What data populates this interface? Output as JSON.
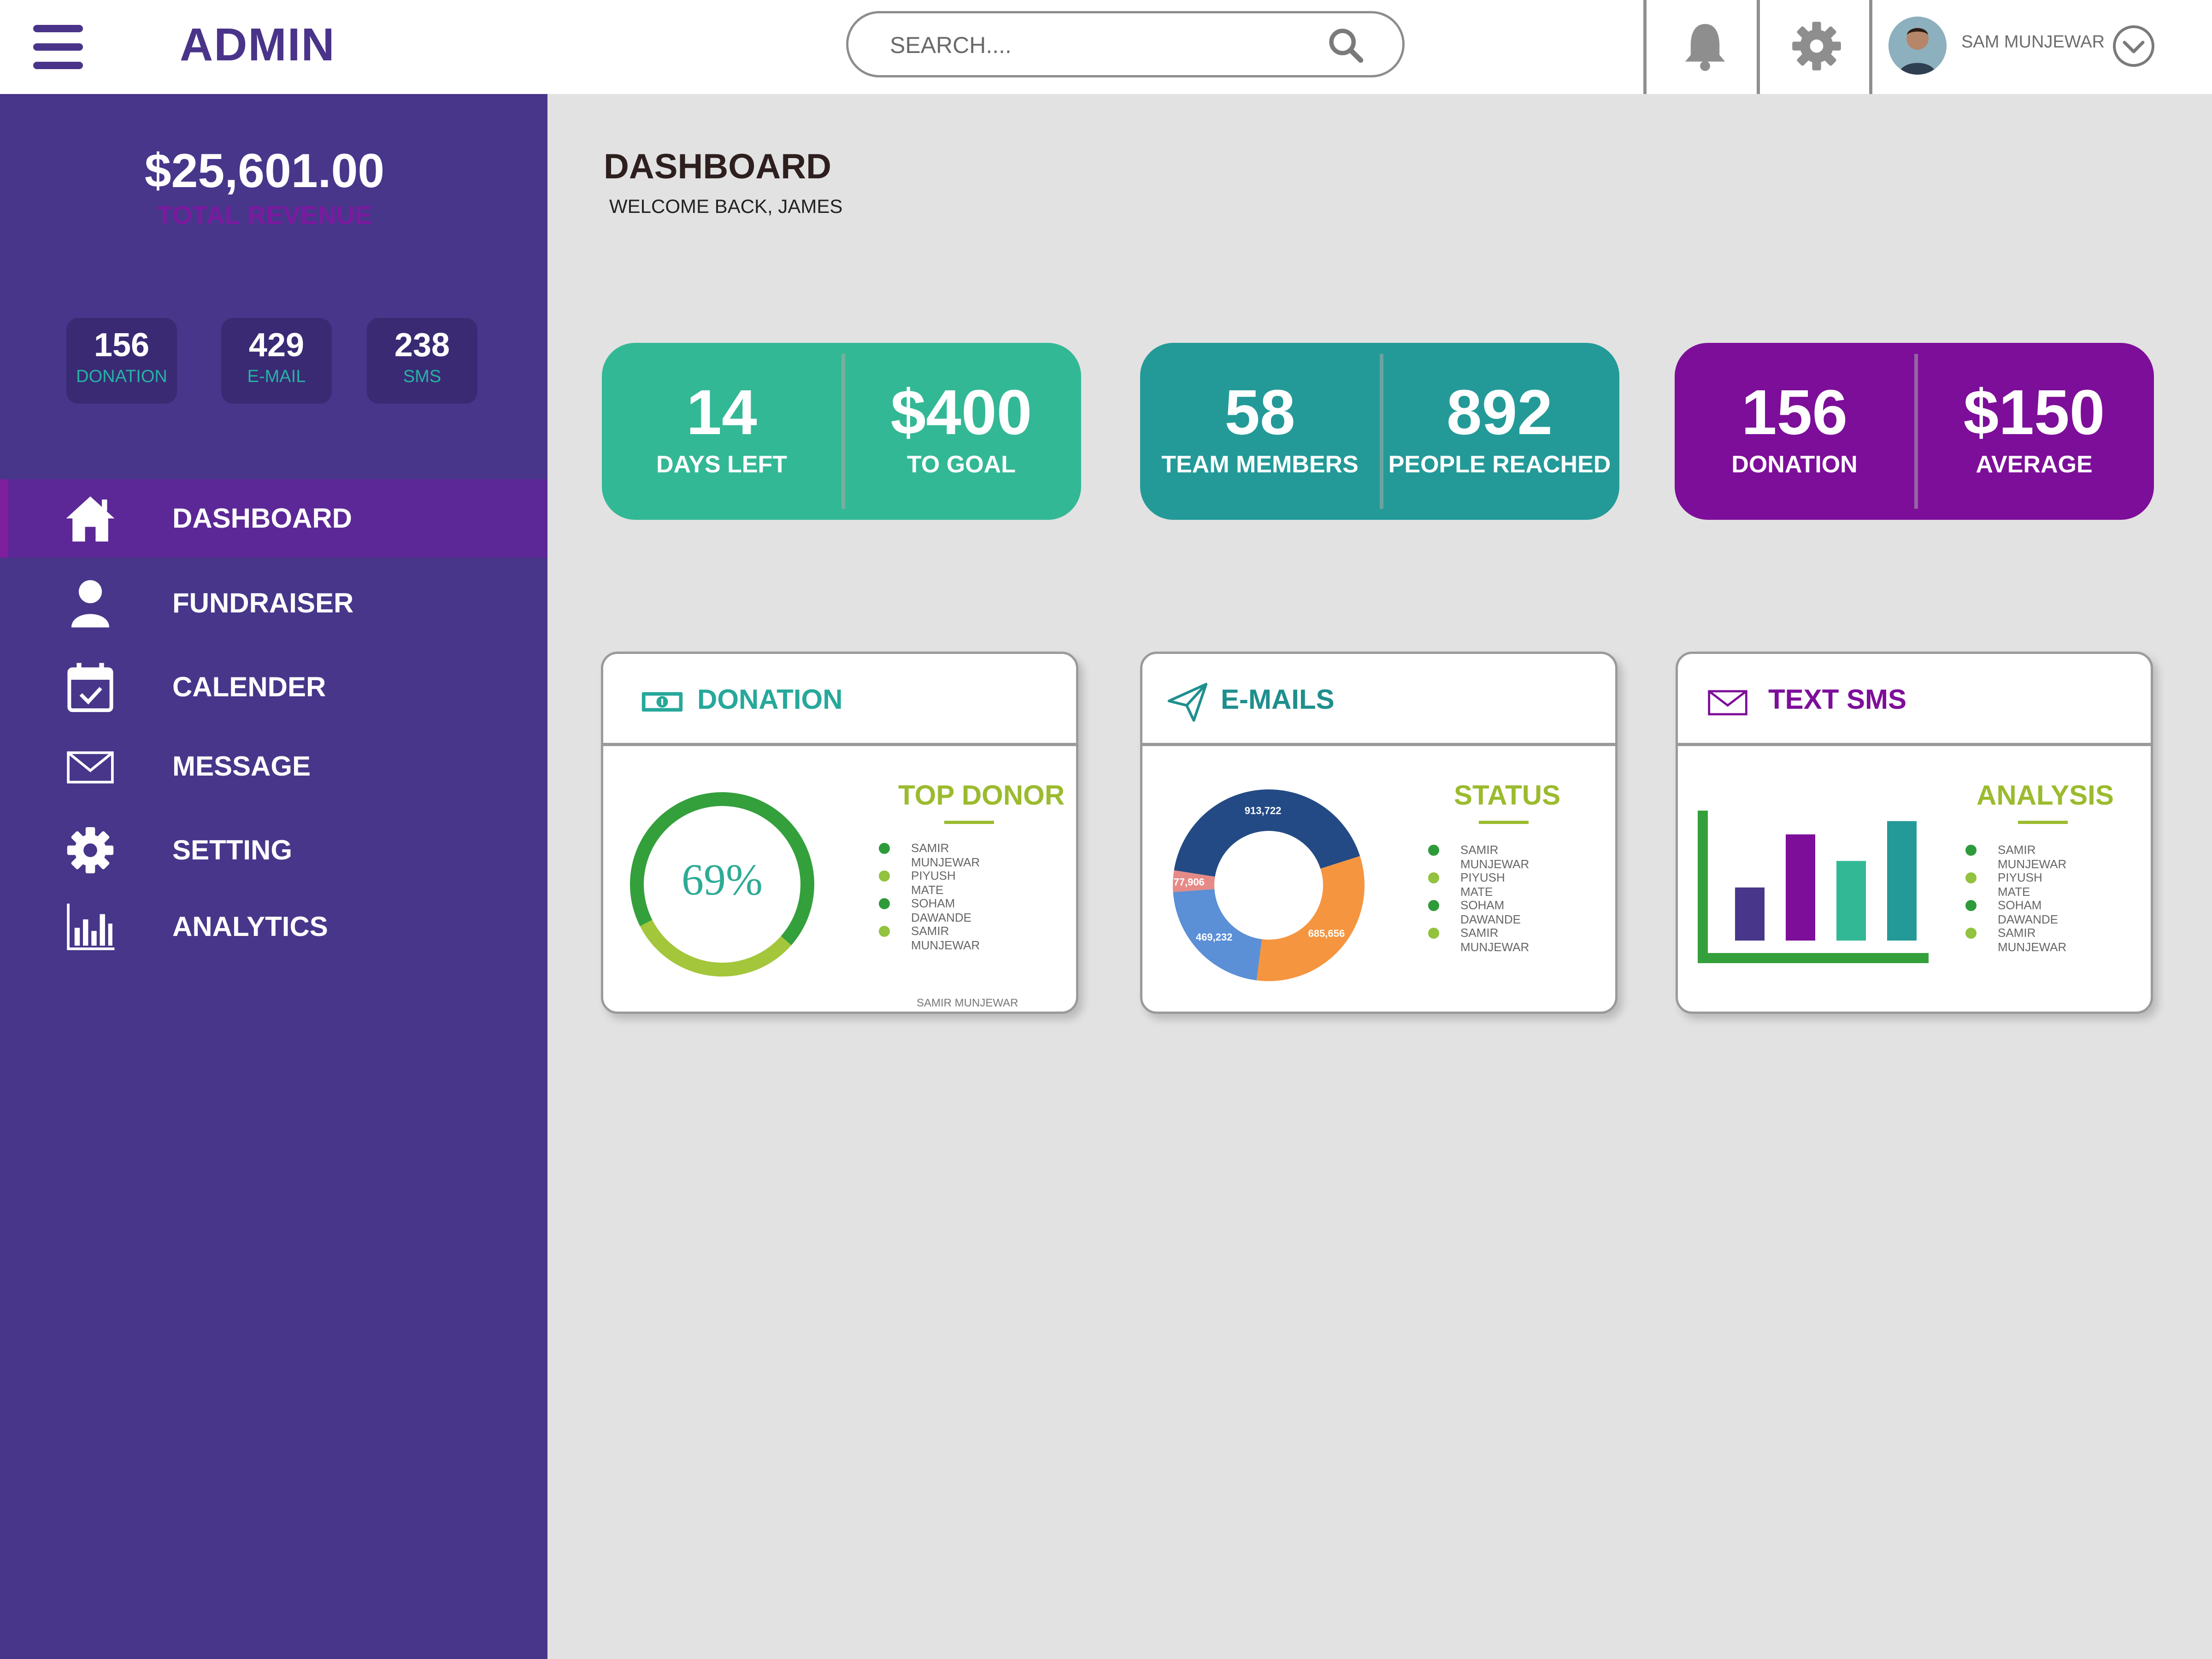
{
  "header": {
    "brand": "ADMIN",
    "search_placeholder": "SEARCH....",
    "user_name": "SAM MUNJEWAR"
  },
  "sidebar": {
    "revenue_value": "$25,601.00",
    "revenue_label": "TOTAL REVENUE",
    "mini_stats": [
      {
        "value": "156",
        "label": "DONATION"
      },
      {
        "value": "429",
        "label": "E-MAIL"
      },
      {
        "value": "238",
        "label": "SMS"
      }
    ],
    "nav": [
      {
        "label": "DASHBOARD",
        "icon": "home-icon",
        "active": true
      },
      {
        "label": "FUNDRAISER",
        "icon": "user-icon",
        "active": false
      },
      {
        "label": "CALENDER",
        "icon": "calendar-icon",
        "active": false
      },
      {
        "label": "MESSAGE",
        "icon": "envelope-icon",
        "active": false
      },
      {
        "label": "SETTING",
        "icon": "gear-icon",
        "active": false
      },
      {
        "label": "ANALYTICS",
        "icon": "bar-chart-icon",
        "active": false
      }
    ]
  },
  "main": {
    "title": "DASHBOARD",
    "subtitle": "WELCOME BACK,  JAMES"
  },
  "stat_cards": [
    {
      "color": "#33b895",
      "left_value": "14",
      "left_label": "DAYS LEFT",
      "right_value": "$400",
      "right_label": "TO GOAL"
    },
    {
      "color": "#239a98",
      "left_value": "58",
      "left_label": "TEAM MEMBERS",
      "right_value": "892",
      "right_label": "PEOPLE REACHED"
    },
    {
      "color": "#7d0e99",
      "left_value": "156",
      "left_label": "DONATION",
      "right_value": "$150",
      "right_label": "AVERAGE"
    }
  ],
  "cards": {
    "donation": {
      "title": "DONATION",
      "title_color": "#26a89a",
      "icon": "money-icon",
      "section_title": "TOP DONOR",
      "legend": [
        "SAMIR MUNJEWAR",
        "PIYUSH MATE",
        "SOHAM DAWANDE",
        "SAMIR MUNJEWAR"
      ],
      "extra_label": "SAMIR MUNJEWAR"
    },
    "emails": {
      "title": "E-MAILS",
      "title_color": "#1f8f8d",
      "icon": "paper-plane-icon",
      "section_title": "STATUS",
      "legend": [
        "SAMIR MUNJEWAR",
        "PIYUSH MATE",
        "SOHAM DAWANDE",
        "SAMIR MUNJEWAR"
      ]
    },
    "sms": {
      "title": "TEXT SMS",
      "title_color": "#7d0e99",
      "icon": "envelope-icon",
      "section_title": "ANALYSIS",
      "legend": [
        "SAMIR MUNJEWAR",
        "PIYUSH MATE",
        "SOHAM DAWANDE",
        "SAMIR MUNJEWAR"
      ]
    }
  },
  "colors": {
    "sidebar": "#48368a",
    "accent_green": "#9bbb2e",
    "legend_dark": "#2e9b3a",
    "legend_light": "#92c23e"
  },
  "chart_data": [
    {
      "type": "pie",
      "variant": "donut-progress",
      "center_label": "69%",
      "values": [
        69,
        31
      ],
      "colors": [
        "#34a03c",
        "#a4c63b"
      ]
    },
    {
      "type": "pie",
      "variant": "donut",
      "values": [
        913722,
        685656,
        469232,
        77906
      ],
      "labels": [
        "913,722",
        "685,656",
        "469,232",
        "77,906"
      ],
      "colors": [
        "#234a84",
        "#f5953f",
        "#5b8fd6",
        "#e58a87"
      ]
    },
    {
      "type": "bar",
      "values": [
        36,
        72,
        54,
        81
      ],
      "ylim": [
        0,
        100
      ],
      "colors": [
        "#48368a",
        "#7d0e99",
        "#33b895",
        "#239a98"
      ],
      "axis_color": "#34a03c"
    }
  ]
}
